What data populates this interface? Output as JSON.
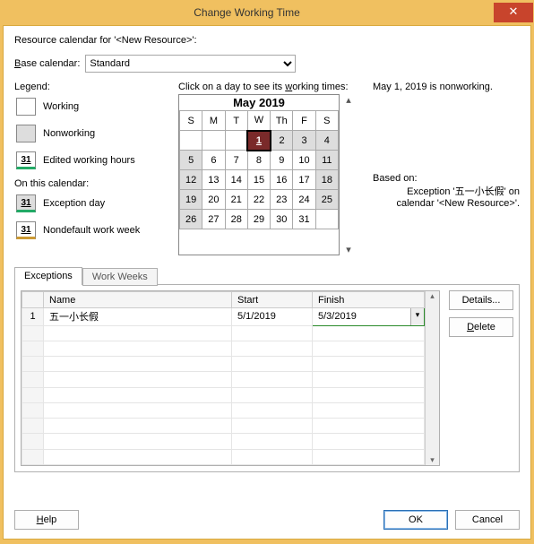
{
  "window": {
    "title": "Change Working Time"
  },
  "header": {
    "resource_line": "Resource calendar for '<New Resource>':",
    "base_label_pre": "B",
    "base_label_rest": "ase calendar:",
    "base_value": "Standard"
  },
  "legend": {
    "title": "Legend:",
    "working": "Working",
    "nonworking": "Nonworking",
    "edited": "Edited working hours",
    "edited_num": "31",
    "on_this": "On this calendar:",
    "exception_num": "31",
    "exception": "Exception day",
    "nondefault_num": "31",
    "nondefault": "Nondefault work week"
  },
  "calendar": {
    "hint_pre": "Click on a day to see its ",
    "hint_u": "w",
    "hint_post": "orking times:",
    "title": "May 2019",
    "dow": [
      "S",
      "M",
      "T",
      "W",
      "Th",
      "F",
      "S"
    ],
    "rows": [
      [
        "",
        "",
        "",
        "1",
        "2",
        "3",
        "4"
      ],
      [
        "5",
        "6",
        "7",
        "8",
        "9",
        "10",
        "11"
      ],
      [
        "12",
        "13",
        "14",
        "15",
        "16",
        "17",
        "18"
      ],
      [
        "19",
        "20",
        "21",
        "22",
        "23",
        "24",
        "25"
      ],
      [
        "26",
        "27",
        "28",
        "29",
        "30",
        "31",
        ""
      ]
    ],
    "selected": "1",
    "weekend_cols": [
      0,
      6
    ],
    "nonwork_days": [
      "1",
      "2",
      "3"
    ]
  },
  "info": {
    "status": "May 1, 2019 is nonworking.",
    "based_label": "Based on:",
    "based_text": "Exception '五一小长假' on calendar '<New Resource>'."
  },
  "tabs": {
    "exceptions": "Exceptions",
    "workweeks": "Work Weeks"
  },
  "grid": {
    "headers": {
      "name": "Name",
      "start": "Start",
      "finish": "Finish"
    },
    "row1": {
      "num": "1",
      "name": "五一小长假",
      "start": "5/1/2019",
      "finish": "5/3/2019"
    }
  },
  "buttons": {
    "details": "Details...",
    "delete": "Delete",
    "help": "Help",
    "ok": "OK",
    "cancel": "Cancel"
  }
}
